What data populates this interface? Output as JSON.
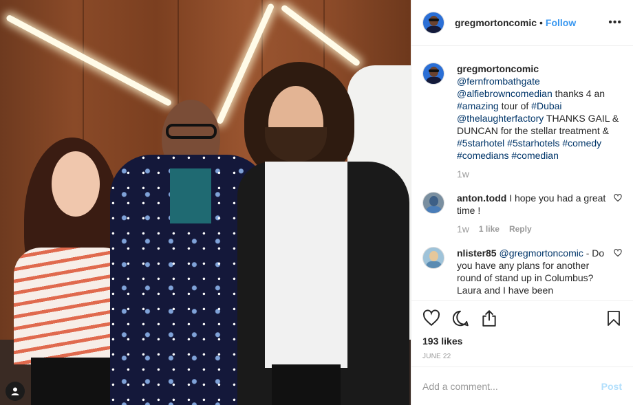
{
  "header": {
    "username": "gregmortoncomic",
    "separator": "•",
    "follow_label": "Follow",
    "more_icon": "more-options-icon"
  },
  "caption": {
    "username": "gregmortoncomic",
    "parts": {
      "m1": "@fernfrombathgate",
      "m2": "@alfiebrowncomedian",
      "t1": " thanks 4 an ",
      "h1": "#amazing",
      "t2": " tour of ",
      "h2": "#Dubai",
      "m3": "@thelaughterfactory",
      "t3": " THANKS GAIL & DUNCAN for the stellar treatment & ",
      "h3": "#5starhotel",
      "h4": "#5starhotels",
      "h5": "#comedy",
      "h6": "#comedians",
      "h7": "#comedian"
    },
    "time": "1w"
  },
  "comments": [
    {
      "username": "anton.todd",
      "text": " I hope you had a great time !",
      "time": "1w",
      "likes": "1 like",
      "reply": "Reply"
    },
    {
      "username": "nlister85",
      "mention": "@gregmortoncomic",
      "text": " - Do you have any plans for another round of stand up in Columbus? Laura and I have been"
    }
  ],
  "actions": {
    "likes": "193 likes",
    "date": "JUNE 22"
  },
  "composer": {
    "placeholder": "Add a comment...",
    "post_label": "Post"
  },
  "colors": {
    "link": "#003569",
    "follow": "#3897f0",
    "post_disabled": "#b2dffc",
    "muted": "#999999"
  }
}
